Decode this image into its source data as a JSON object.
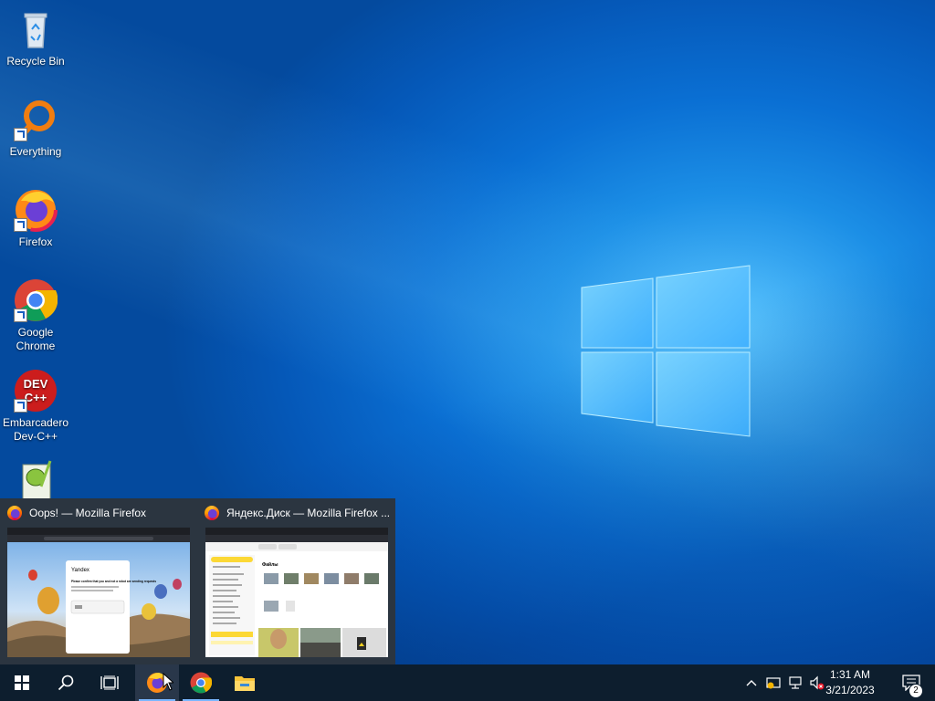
{
  "desktop": {
    "icons": [
      {
        "label": "Recycle Bin",
        "icon": "recycle-bin-icon"
      },
      {
        "label": "Everything",
        "icon": "everything-search-icon"
      },
      {
        "label": "Firefox",
        "icon": "firefox-icon"
      },
      {
        "label": "Google Chrome",
        "icon": "chrome-icon"
      },
      {
        "label": "Embarcadero Dev-C++",
        "icon": "devcpp-icon",
        "logo_text": "DEV C++"
      },
      {
        "label": "",
        "icon": "notepad-plus-plus-icon"
      }
    ]
  },
  "thumbnails": [
    {
      "title": "Oops! — Mozilla Firefox",
      "page_heading": "Yandex",
      "page_text": "Please confirm that you and not a robot are sending requests"
    },
    {
      "title": "Яндекс.Диск — Mozilla Firefox ...",
      "page_heading": "Файлы"
    }
  ],
  "taskbar": {
    "start": "windows-start-icon",
    "search": "search-icon",
    "task_view": "task-view-icon",
    "apps": [
      "firefox-icon",
      "chrome-icon",
      "file-explorer-icon"
    ],
    "tray": {
      "time": "1:31 AM",
      "date": "3/21/2023",
      "notifications_count": "2"
    }
  },
  "colors": {
    "taskbar_bg": "#0d1e2e",
    "thumb_bg": "#2b3540",
    "accent": "#7ab7ff"
  }
}
